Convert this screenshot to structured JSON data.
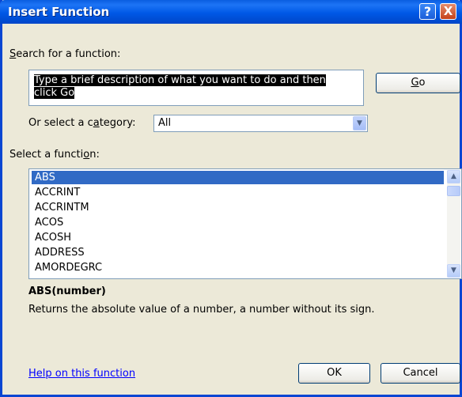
{
  "window": {
    "title": "Insert Function",
    "help_glyph": "?",
    "close_glyph": "X"
  },
  "search": {
    "label": "Search for a function:",
    "text_line1": "Type a brief description of what you want to do and then",
    "text_line2": "click Go",
    "go_button": "Go"
  },
  "category": {
    "label": "Or select a category:",
    "value": "All"
  },
  "functions": {
    "label": "Select a function:",
    "items": [
      "ABS",
      "ACCRINT",
      "ACCRINTM",
      "ACOS",
      "ACOSH",
      "ADDRESS",
      "AMORDEGRC"
    ],
    "selected": "ABS"
  },
  "detail": {
    "syntax": "ABS(number)",
    "description": "Returns the absolute value of a number, a number without its sign."
  },
  "footer": {
    "help_link": "Help on this function",
    "ok_button": "OK",
    "cancel_button": "Cancel"
  },
  "colors": {
    "titlebar": "#0058E6",
    "face": "#ECE9D8",
    "selection": "#316AC5",
    "link": "#0000FF"
  },
  "icons": {
    "scroll_up": "chevron-up-icon",
    "scroll_down": "chevron-down-icon",
    "dropdown": "chevron-down-icon"
  }
}
